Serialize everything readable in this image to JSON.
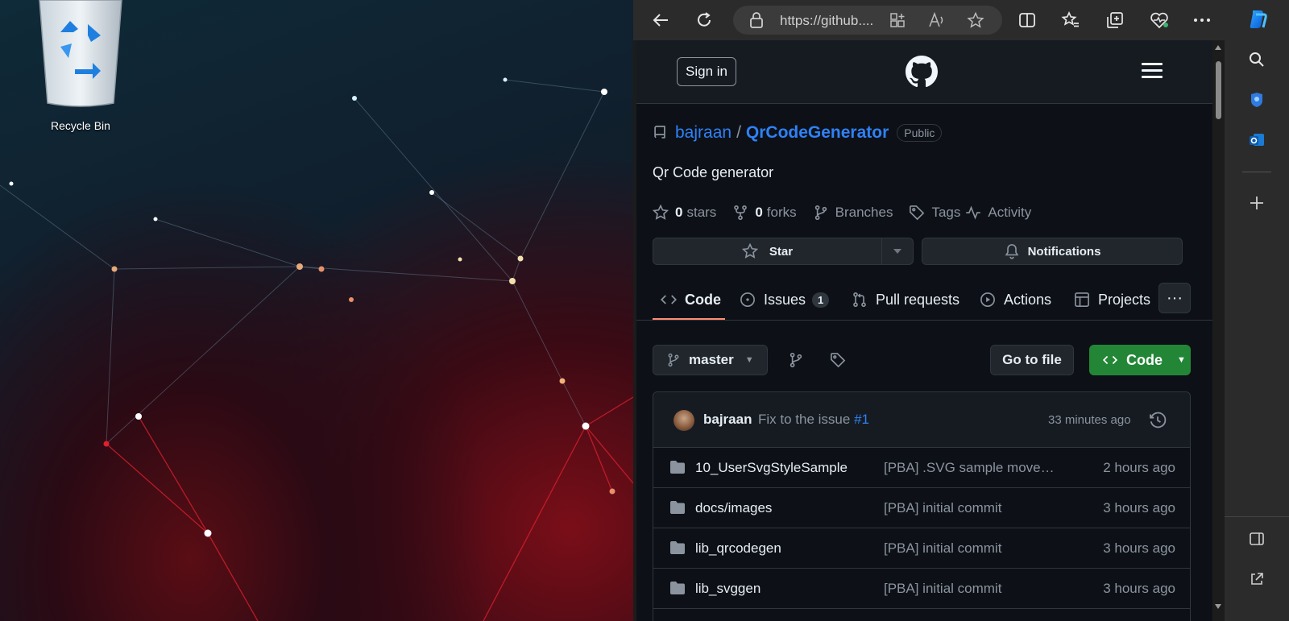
{
  "desktop": {
    "recycle_bin_label": "Recycle Bin"
  },
  "browser": {
    "url": "https://github...."
  },
  "github": {
    "sign_in": "Sign in",
    "owner": "bajraan",
    "separator": "/",
    "repo": "QrCodeGenerator",
    "visibility": "Public",
    "description": "Qr Code generator",
    "stats": {
      "stars_count": "0",
      "stars_label": "stars",
      "forks_count": "0",
      "forks_label": "forks",
      "branches_label": "Branches",
      "tags_label": "Tags",
      "activity_label": "Activity"
    },
    "star_button": "Star",
    "notifications_button": "Notifications",
    "tabs": [
      {
        "label": "Code"
      },
      {
        "label": "Issues",
        "count": "1"
      },
      {
        "label": "Pull requests"
      },
      {
        "label": "Actions"
      },
      {
        "label": "Projects"
      }
    ],
    "more_tabs": "···",
    "branch": "master",
    "go_to_file": "Go to file",
    "code_button": "Code",
    "latest_commit": {
      "author": "bajraan",
      "message": "Fix to the issue ",
      "issue_link": "#1",
      "time": "33 minutes ago"
    },
    "files": [
      {
        "name": "10_UserSvgStyleSample",
        "message": "[PBA] .SVG sample move t...",
        "time": "2 hours ago"
      },
      {
        "name": "docs/images",
        "message": "[PBA] initial commit",
        "time": "3 hours ago"
      },
      {
        "name": "lib_qrcodegen",
        "message": "[PBA] initial commit",
        "time": "3 hours ago"
      },
      {
        "name": "lib_svggen",
        "message": "[PBA] initial commit",
        "time": "3 hours ago"
      }
    ]
  },
  "colors": {
    "accent_link": "#2f81f7",
    "code_button": "#238636",
    "tab_underline": "#fd8c73",
    "page_bg": "#0d1117"
  }
}
